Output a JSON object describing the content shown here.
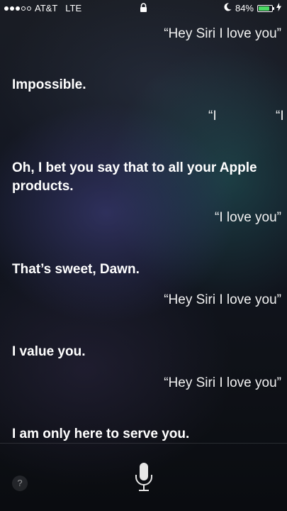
{
  "status_bar": {
    "carrier": "AT&T",
    "network": "LTE",
    "battery_percent": "84%",
    "battery_level": 0.84,
    "battery_color": "#4cd964",
    "icons": [
      "lock-icon",
      "moon-icon",
      "charging-bolt-icon"
    ]
  },
  "conversation": {
    "messages": [
      {
        "speaker": "user",
        "text": "“Hey Siri I love you”"
      },
      {
        "speaker": "siri",
        "text": "Impossible."
      },
      {
        "speaker": "user",
        "text": "“I"
      },
      {
        "speaker": "user",
        "text": "“I"
      },
      {
        "speaker": "siri",
        "text": "Oh, I bet you say that to all your Apple products."
      },
      {
        "speaker": "user",
        "text": "“I love you”"
      },
      {
        "speaker": "siri",
        "text": "That’s sweet, Dawn."
      },
      {
        "speaker": "user",
        "text": "“Hey Siri I love you”"
      },
      {
        "speaker": "siri",
        "text": "I value you."
      },
      {
        "speaker": "user",
        "text": "“Hey Siri I love you”"
      },
      {
        "speaker": "siri",
        "text": "I am only here to serve you."
      }
    ]
  },
  "bottom_bar": {
    "help_label": "?",
    "mic_icon": "microphone-icon"
  }
}
